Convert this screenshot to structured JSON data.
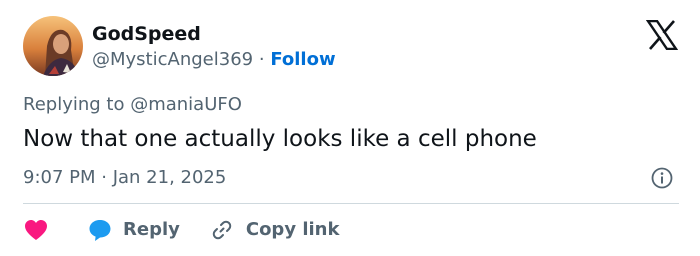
{
  "user": {
    "display_name": "GodSpeed",
    "handle": "@MysticAngel369",
    "separator": "·",
    "follow_label": "Follow"
  },
  "reply_context": {
    "label": "Replying to @maniaUFO"
  },
  "tweet": {
    "text": "Now that one actually looks like a cell phone",
    "timestamp": "9:07 PM · Jan 21, 2025"
  },
  "actions": {
    "reply_label": "Reply",
    "copy_link_label": "Copy link"
  },
  "icons": {
    "logo": "x-logo-icon",
    "info": "info-icon",
    "like": "heart-icon",
    "reply": "speech-bubble-icon",
    "copy_link": "link-icon"
  },
  "colors": {
    "link_blue": "#006fd6",
    "secondary_text": "#536471",
    "heart": "#f91880",
    "reply_bubble": "#1d9bf0",
    "divider": "#cfd9de"
  }
}
